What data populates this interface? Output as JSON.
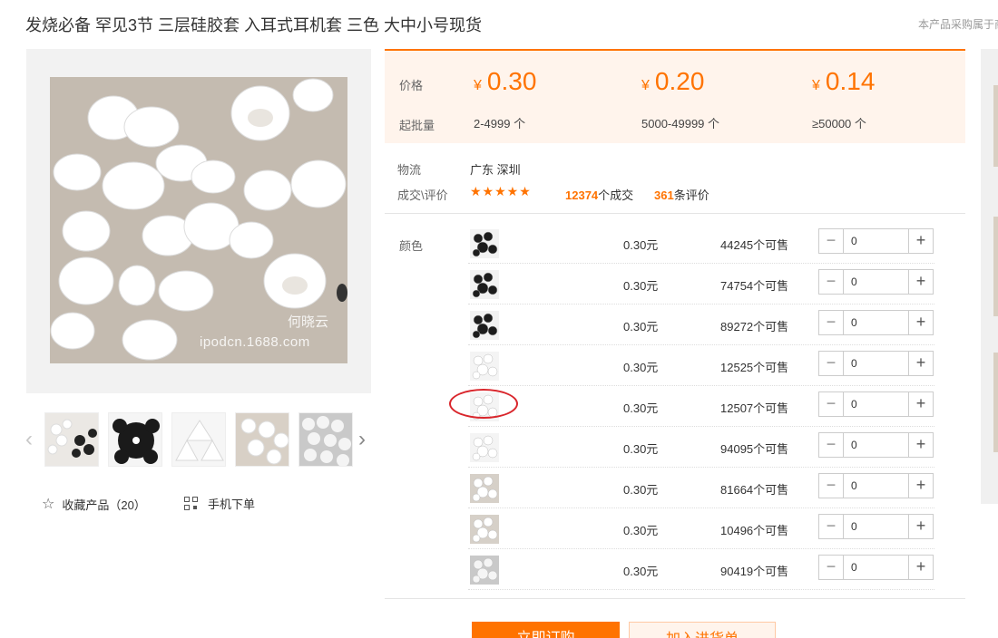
{
  "product": {
    "title": "发烧必备 罕见3节 三层硅胶套 入耳式耳机套 三色 大中小号现货",
    "top_right_note": "本产品采购属于商"
  },
  "image": {
    "watermark_name": "何晓云",
    "watermark_site": "ipodcn.1688.com"
  },
  "actions": {
    "favorite_label": "收藏产品（20）",
    "mobile_order_label": "手机下单"
  },
  "pricing": {
    "price_label": "价格",
    "min_batch_label": "起批量",
    "currency": "¥",
    "tiers": [
      {
        "price": "0.30",
        "quantity": "2-4999 个"
      },
      {
        "price": "0.20",
        "quantity": "5000-49999 个"
      },
      {
        "price": "0.14",
        "quantity": "≥50000 个"
      }
    ]
  },
  "logistics": {
    "label": "物流",
    "location": "广东 深圳"
  },
  "deals": {
    "label": "成交\\评价",
    "stars": "★★★★★",
    "rating": 4.5,
    "deal_count": "12374",
    "deal_suffix": "个成交",
    "review_count": "361",
    "review_suffix": "条评价"
  },
  "sku": {
    "color_label": "颜色",
    "rows": [
      {
        "price": "0.30元",
        "stock": "44245个可售",
        "qty": "0"
      },
      {
        "price": "0.30元",
        "stock": "74754个可售",
        "qty": "0"
      },
      {
        "price": "0.30元",
        "stock": "89272个可售",
        "qty": "0"
      },
      {
        "price": "0.30元",
        "stock": "12525个可售",
        "qty": "0"
      },
      {
        "price": "0.30元",
        "stock": "12507个可售",
        "qty": "0"
      },
      {
        "price": "0.30元",
        "stock": "94095个可售",
        "qty": "0"
      },
      {
        "price": "0.30元",
        "stock": "81664个可售",
        "qty": "0"
      },
      {
        "price": "0.30元",
        "stock": "10496个可售",
        "qty": "0"
      },
      {
        "price": "0.30元",
        "stock": "90419个可售",
        "qty": "0"
      }
    ],
    "minus_symbol": "−",
    "plus_symbol": "+"
  },
  "buttons": {
    "buy_now": "立即订购",
    "add_to_cart": "加入进货单"
  },
  "colors": {
    "accent": "#ff7300",
    "price_panel_bg": "#fff4ec",
    "highlight_circle": "#d9262c"
  }
}
